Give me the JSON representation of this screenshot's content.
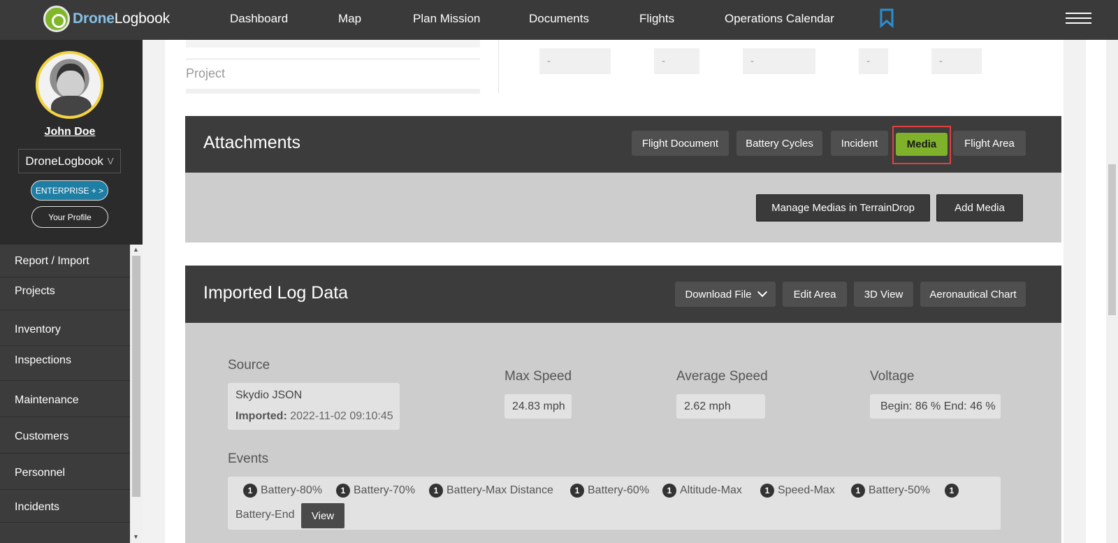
{
  "app": {
    "logo_part1": "Drone",
    "logo_part2": "Logbook"
  },
  "nav": {
    "items": [
      "Dashboard",
      "Map",
      "Plan Mission",
      "Documents",
      "Flights",
      "Operations Calendar"
    ]
  },
  "sidebar": {
    "user_name": "John Doe",
    "org_name": "DroneLogbook",
    "org_chevron": "V",
    "enterprise_label": "ENTERPRISE + >",
    "profile_label": "Your Profile",
    "menu": [
      "Report / Import",
      "Projects",
      "Inventory",
      "Inspections",
      "Maintenance",
      "Customers",
      "Personnel",
      "Incidents"
    ]
  },
  "top_section": {
    "project_label": "Project",
    "dash_values": [
      "-",
      "-",
      "-",
      "-",
      "-"
    ]
  },
  "attachments": {
    "title": "Attachments",
    "tabs": [
      "Flight Document",
      "Battery Cycles",
      "Incident",
      "Media",
      "Flight Area"
    ],
    "active_tab": "Media",
    "manage_button": "Manage Medias in TerrainDrop",
    "add_button": "Add Media"
  },
  "imported_log": {
    "title": "Imported Log Data",
    "download_label": "Download File",
    "edit_area_label": "Edit Area",
    "view_3d_label": "3D View",
    "aero_chart_label": "Aeronautical Chart",
    "source_label": "Source",
    "source_value": "Skydio JSON",
    "imported_label": "Imported:",
    "imported_value": "2022-11-02 09:10:45",
    "max_speed_label": "Max Speed",
    "max_speed_value": "24.83 mph",
    "avg_speed_label": "Average Speed",
    "avg_speed_value": "2.62 mph",
    "voltage_label": "Voltage",
    "voltage_value": "Begin: 86 % End: 46 %",
    "events_label": "Events",
    "events": [
      {
        "count": "1",
        "name": "Battery-80%"
      },
      {
        "count": "1",
        "name": "Battery-70%"
      },
      {
        "count": "1",
        "name": "Battery-Max Distance"
      },
      {
        "count": "1",
        "name": "Battery-60%"
      },
      {
        "count": "1",
        "name": "Altitude-Max"
      },
      {
        "count": "1",
        "name": "Speed-Max"
      },
      {
        "count": "1",
        "name": "Battery-50%"
      },
      {
        "count": "1",
        "name": "Battery-End"
      }
    ],
    "view_label": "View"
  },
  "colors": {
    "accent_green": "#7fb12a",
    "header_dark": "#3a3a3a",
    "enterprise_blue": "#1f7ea4",
    "highlight_red": "#e0413f"
  }
}
